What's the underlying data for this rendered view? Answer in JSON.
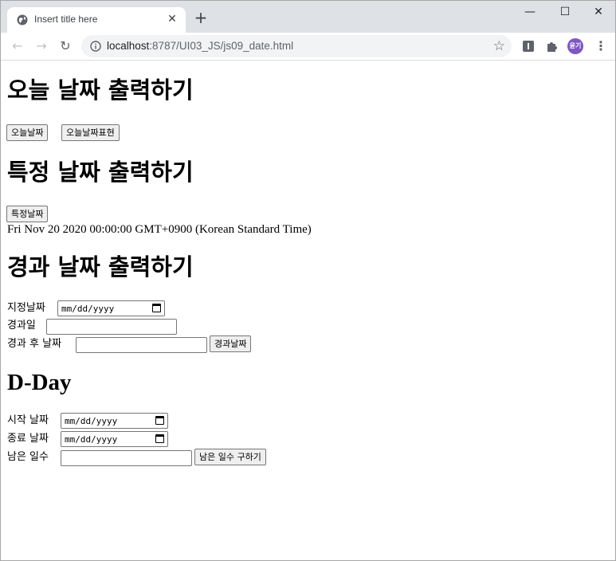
{
  "browser": {
    "tab_title": "Insert title here",
    "url_host": "localhost",
    "url_path": ":8787/UI03_JS/js09_date.html",
    "profile_initials": "윤기"
  },
  "page": {
    "sections": {
      "today": {
        "heading": "오늘 날짜 출력하기",
        "btn_today": "오늘날짜",
        "btn_today_format": "오늘날짜표현"
      },
      "specific": {
        "heading": "특정 날짜 출력하기",
        "btn_specific": "특정날짜",
        "output": "Fri Nov 20 2020 00:00:00 GMT+0900 (Korean Standard Time)"
      },
      "elapsed": {
        "heading": "경과 날짜 출력하기",
        "label_date": "지정날짜",
        "date_placeholder": "mm/dd/yyyy",
        "label_days": "경과일",
        "label_after": "경과 후 날짜",
        "btn_elapsed": "경과날짜"
      },
      "dday": {
        "heading": "D-Day",
        "label_start": "시작 날짜",
        "label_end": "종료 날짜",
        "date_placeholder": "mm/dd/yyyy",
        "label_remaining": "남은 일수",
        "btn_remaining": "남은 일수 구하기"
      }
    }
  }
}
